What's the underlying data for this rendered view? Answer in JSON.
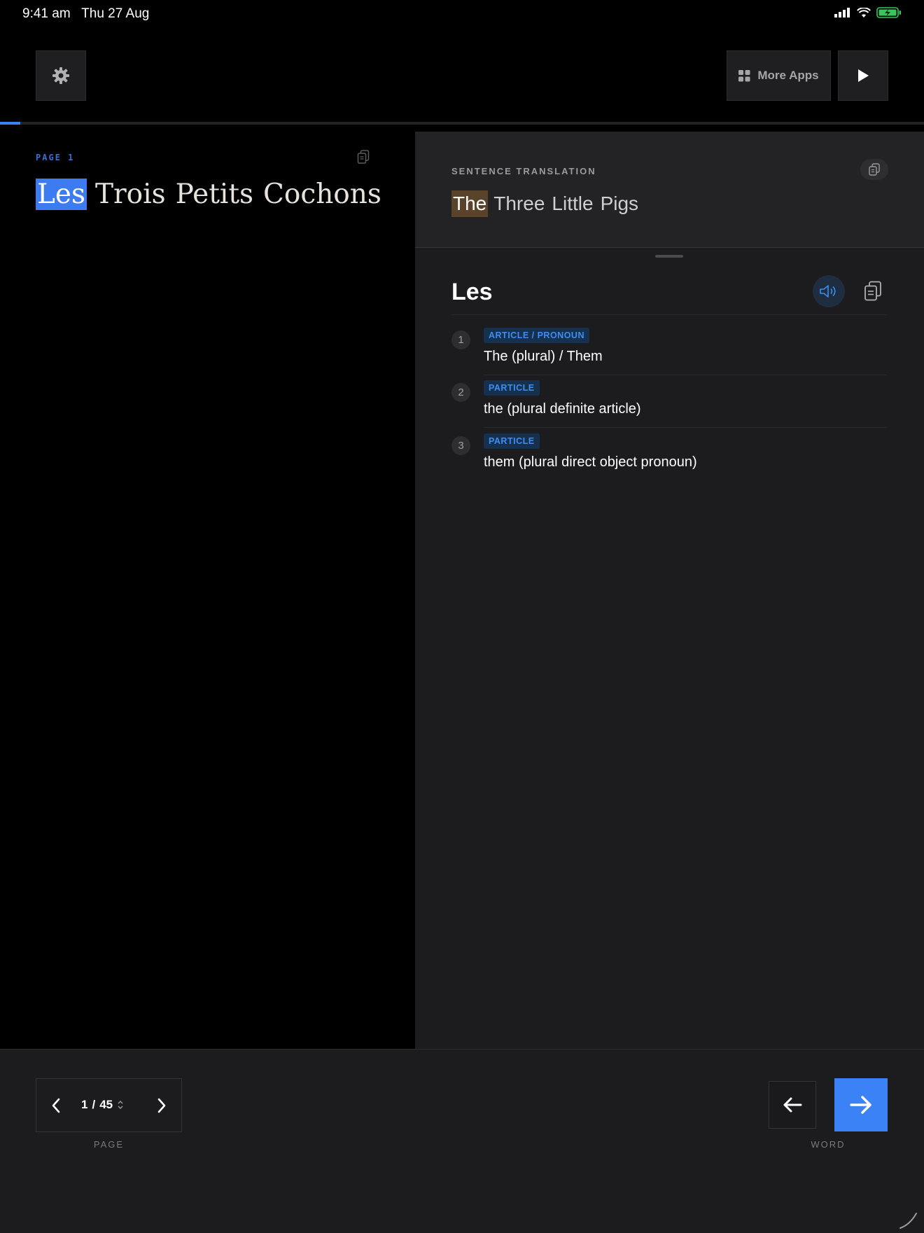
{
  "status_bar": {
    "time": "9:41 am",
    "date": "Thu 27 Aug"
  },
  "header": {
    "more_apps_label": "More Apps"
  },
  "progress": {
    "fraction": 0.022
  },
  "reader": {
    "page_label": "PAGE 1",
    "words": [
      "Les",
      "Trois",
      "Petits",
      "Cochons"
    ],
    "active_word_index": 0
  },
  "translation": {
    "label": "SENTENCE TRANSLATION",
    "words": [
      "The",
      "Three",
      "Little",
      "Pigs"
    ],
    "active_word_index": 0
  },
  "dictionary": {
    "word": "Les",
    "definitions": [
      {
        "num": "1",
        "pos": "ARTICLE / PRONOUN",
        "text": "The (plural) / Them"
      },
      {
        "num": "2",
        "pos": "PARTICLE",
        "text": "the (plural definite article)"
      },
      {
        "num": "3",
        "pos": "PARTICLE",
        "text": "them (plural direct object pronoun)"
      }
    ]
  },
  "pager": {
    "current": "1",
    "separator": "/",
    "total": "45",
    "caption": "PAGE"
  },
  "word_nav": {
    "caption": "WORD"
  },
  "colors": {
    "accent": "#3b82f6",
    "highlight_source": "#3d7bf0",
    "highlight_translation": "#5a432b",
    "tag_text": "#3d8ef0"
  },
  "icons": [
    "settings-gear-icon",
    "grid-icon",
    "play-icon",
    "copy-icon",
    "speaker-icon",
    "chevron-left-icon",
    "chevron-right-icon",
    "up-down-icon",
    "arrow-left-icon",
    "arrow-right-icon"
  ]
}
